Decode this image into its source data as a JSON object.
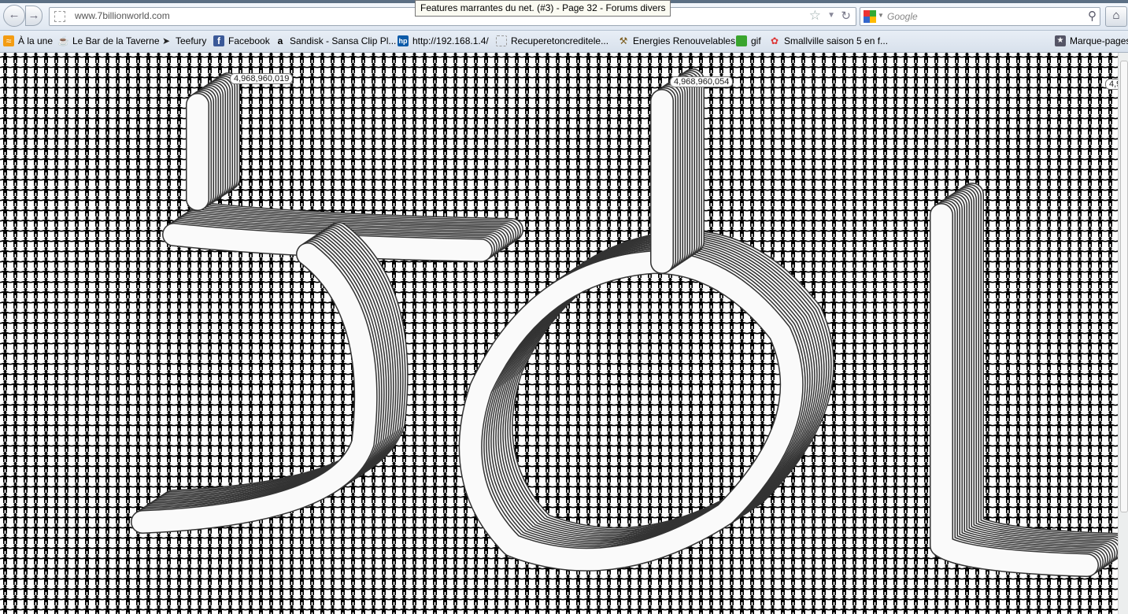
{
  "browser": {
    "tooltip": "Features marrantes du net. (#3) - Page 32 - Forums divers",
    "url": "www.7billionworld.com",
    "search_placeholder": "Google",
    "icons": {
      "back": "back-arrow-icon",
      "forward": "forward-arrow-icon",
      "star": "star-icon",
      "reload": "reload-icon",
      "search": "magnifier-icon",
      "home": "home-icon"
    }
  },
  "bookmarks": [
    {
      "label": "À la une",
      "icon": "rss-icon"
    },
    {
      "label": "Le Bar de la Taverne",
      "icon": "mug-icon"
    },
    {
      "label": "Teefury",
      "icon": "bird-icon"
    },
    {
      "label": "Facebook",
      "icon": "facebook-icon"
    },
    {
      "label": "Sandisk - Sansa Clip Pl...",
      "icon": "amazon-icon"
    },
    {
      "label": "http://192.168.1.4/",
      "icon": "hp-icon"
    },
    {
      "label": "Recuperetoncreditele...",
      "icon": "blank-page-icon"
    },
    {
      "label": "Energies Renouvelables",
      "icon": "tools-icon"
    },
    {
      "label": "gif",
      "icon": "green-cube-icon"
    },
    {
      "label": "Smallville saison 5 en f...",
      "icon": "flower-icon"
    },
    {
      "label": "Marque-pages",
      "icon": "bookmarks-folder-icon"
    }
  ],
  "page": {
    "counters": [
      "4,968,960,019",
      "4,968,960,054",
      "4,9"
    ]
  }
}
